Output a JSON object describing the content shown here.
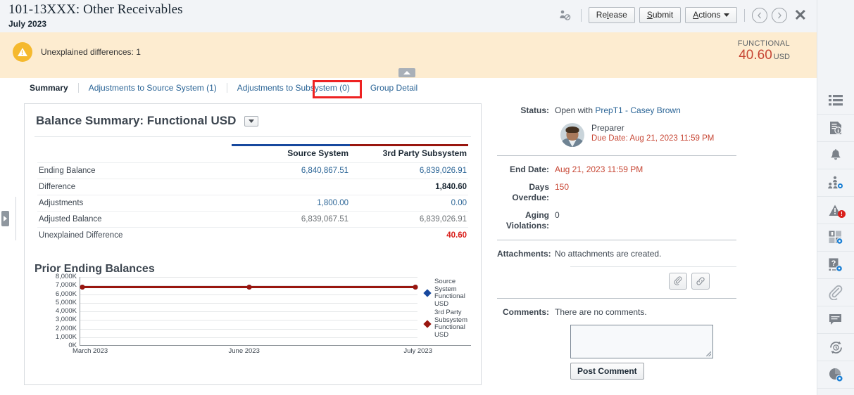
{
  "header": {
    "doc_title": "101-13XXX: Other Receivables",
    "period": "July 2023",
    "user_icon": "user-settings-icon",
    "buttons": {
      "release": "Release",
      "release_underline": "l",
      "submit": "Submit",
      "actions": "Actions"
    },
    "nav": {
      "prev": "‹",
      "next": "›",
      "close": "✕"
    }
  },
  "alert": {
    "icon": "warning-triangle-icon",
    "message": "Unexplained differences: 1",
    "functional_label": "FUNCTIONAL",
    "functional_amount": "40.60",
    "functional_currency": "USD",
    "collapse_icon": "chevron-up-icon"
  },
  "tabs": [
    {
      "label": "Summary",
      "active": true
    },
    {
      "label": "Adjustments to Source System (1)",
      "active": false
    },
    {
      "label": "Adjustments to Subsystem (0)",
      "active": false
    },
    {
      "label": "Group Detail",
      "active": false,
      "highlighted": true
    }
  ],
  "balance_summary": {
    "title": "Balance Summary: Functional USD",
    "dropdown_icon": "chevron-down-icon",
    "columns": [
      "",
      "Source System",
      "3rd Party Subsystem"
    ],
    "column_accent_source": "#17489e",
    "column_accent_subsystem": "#99160f",
    "rows": [
      {
        "label": "Ending Balance",
        "source": "6,840,867.51",
        "source_style": "link",
        "subsystem": "6,839,026.91",
        "subsystem_style": "link"
      },
      {
        "label": "Difference",
        "source": "",
        "source_style": "plain",
        "subsystem": "1,840.60",
        "subsystem_style": "bold"
      },
      {
        "label": "Adjustments",
        "source": "1,800.00",
        "source_style": "link",
        "subsystem": "0.00",
        "subsystem_style": "link"
      },
      {
        "label": "Adjusted Balance",
        "source": "6,839,067.51",
        "source_style": "gray",
        "subsystem": "6,839,026.91",
        "subsystem_style": "gray"
      },
      {
        "label": "Unexplained Difference",
        "source": "",
        "source_style": "plain",
        "subsystem": "40.60",
        "subsystem_style": "red"
      }
    ]
  },
  "chart_data": {
    "type": "line",
    "title": "Prior Ending Balances",
    "xlabel": "",
    "ylabel": "",
    "categories": [
      "March 2023",
      "June 2023",
      "July 2023"
    ],
    "x_tick_labels": [
      "March 2023",
      "June 2023",
      "July 2023"
    ],
    "y_tick_labels": [
      "0K",
      "1,000K",
      "2,000K",
      "3,000K",
      "4,000K",
      "5,000K",
      "6,000K",
      "7,000K",
      "8,000K"
    ],
    "ylim": [
      0,
      8000
    ],
    "grid": true,
    "legend_position": "right",
    "series": [
      {
        "name": "Source System Functional USD",
        "color": "#17489e",
        "values": [
          6840.9,
          6840.9,
          6840.9
        ]
      },
      {
        "name": "3rd Party Subsystem Functional USD",
        "color": "#99160f",
        "values": [
          6839.0,
          6839.0,
          6839.0
        ]
      }
    ]
  },
  "details": {
    "status_label": "Status:",
    "status_prefix": "Open with ",
    "status_link": "PrepT1 - Casey Brown",
    "preparer_role": "Preparer",
    "preparer_due": "Due Date:  Aug 21, 2023 11:59 PM",
    "end_date_label": "End Date:",
    "end_date_value": "Aug 21, 2023 11:59 PM",
    "days_overdue_label": "Days Overdue:",
    "days_overdue_value": "150",
    "aging_violations_label": "Aging Violations:",
    "aging_violations_value": "0",
    "attachments_label": "Attachments:",
    "attachments_value": "No attachments are created.",
    "attach_file_icon": "paperclip-icon",
    "attach_link_icon": "link-icon",
    "comments_label": "Comments:",
    "comments_value": "There are no comments.",
    "comment_placeholder": "",
    "comment_value": "",
    "post_comment": "Post Comment"
  },
  "rail": [
    {
      "icon": "list-icon",
      "badge": ""
    },
    {
      "icon": "document-info-icon",
      "badge": ""
    },
    {
      "icon": "bell-icon",
      "badge": ""
    },
    {
      "icon": "workflow-users-icon",
      "badge": ""
    },
    {
      "icon": "alert-warning-icon",
      "badge": "!"
    },
    {
      "icon": "dashboard-tiles-icon",
      "badge": ""
    },
    {
      "icon": "questions-icon",
      "badge": ""
    },
    {
      "icon": "attachments-paperclip-icon",
      "badge": ""
    },
    {
      "icon": "comments-icon",
      "badge": ""
    },
    {
      "icon": "history-refresh-icon",
      "badge": ""
    },
    {
      "icon": "pie-clock-icon",
      "badge": ""
    }
  ],
  "left_expander_icon": "chevron-right-icon"
}
